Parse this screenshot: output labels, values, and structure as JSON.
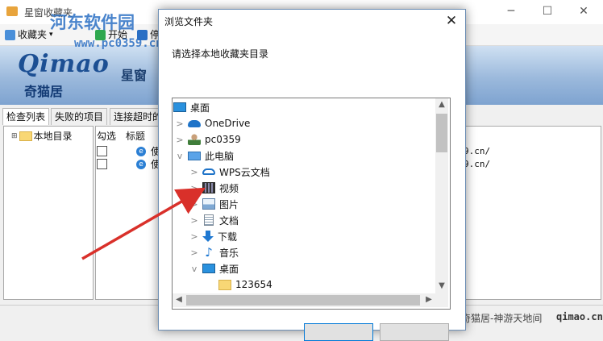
{
  "main_window": {
    "title": "星窗收藏夹",
    "toolbar": {
      "open_label": "收藏夹",
      "start_label": "开始",
      "third_label": "停"
    },
    "watermark": {
      "title": "河东软件园",
      "url": "www.pc0359.cn"
    },
    "banner": {
      "brand_latin": "Qimao",
      "brand_cn": "奇猫居",
      "slogan": "星窗"
    },
    "tabs": [
      "检查列表",
      "失败的项目",
      "连接超时的"
    ],
    "tree_root": "本地目录",
    "list": {
      "headers": [
        "勾选",
        "标题"
      ],
      "rows": [
        {
          "title": "使用",
          "url_tail": "9.cn/"
        },
        {
          "title": "使用",
          "url_tail": "9.cn/"
        }
      ]
    },
    "status_text": "奇猫居-神游天地间",
    "status_logo": "qimao.cn"
  },
  "dialog": {
    "title": "浏览文件夹",
    "prompt": "请选择本地收藏夹目录",
    "tree": [
      {
        "label": "桌面",
        "icon": "desktop-icon",
        "chevron": ""
      },
      {
        "label": "OneDrive",
        "icon": "onedrive-cloud-icon",
        "chevron": ">"
      },
      {
        "label": "pc0359",
        "icon": "user-folder-icon",
        "chevron": ">"
      },
      {
        "label": "此电脑",
        "icon": "computer-icon",
        "chevron": "v"
      },
      {
        "label": "WPS云文档",
        "icon": "cloud-docs-icon",
        "chevron": ">"
      },
      {
        "label": "视频",
        "icon": "video-icon",
        "chevron": ">"
      },
      {
        "label": "图片",
        "icon": "pictures-icon",
        "chevron": ">"
      },
      {
        "label": "文档",
        "icon": "documents-icon",
        "chevron": ">"
      },
      {
        "label": "下载",
        "icon": "download-icon",
        "chevron": ">"
      },
      {
        "label": "音乐",
        "icon": "music-icon",
        "chevron": ">"
      },
      {
        "label": "桌面",
        "icon": "desktop-icon",
        "chevron": "v"
      },
      {
        "label": "123654",
        "icon": "folder-icon",
        "chevron": ""
      }
    ]
  },
  "colors": {
    "arrow": "#d9302a",
    "banner": "#9bb9dc",
    "dialog_border": "#6e8fb5"
  }
}
